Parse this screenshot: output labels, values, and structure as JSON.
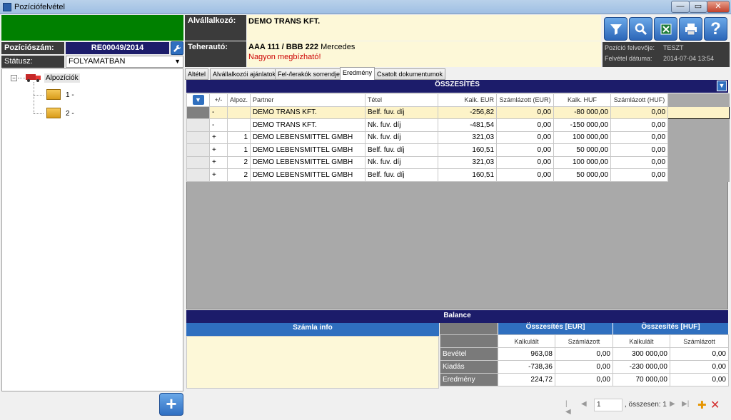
{
  "window": {
    "title": "Pozíciófelvétel",
    "min": "—",
    "max": "▭",
    "close": "✕"
  },
  "left": {
    "pos_label": "Pozíciószám:",
    "pos_value": "RE00049/2014",
    "status_label": "Státusz:",
    "status_value": "FOLYAMATBAN",
    "tree": {
      "root": "Alpozíciók",
      "children": [
        "1 -",
        "2 -"
      ]
    }
  },
  "header": {
    "subcontractor_label": "Alvállalkozó:",
    "subcontractor_value": "DEMO TRANS KFT.",
    "truck_label": "Teherautó:",
    "truck_plate": "AAA 111 / BBB 222",
    "truck_make": "Mercedes",
    "truck_note": "Nagyon megbízható!",
    "info": {
      "creator_label": "Pozíció felvevője:",
      "creator_value": "TESZT",
      "date_label": "Felvétel dátuma:",
      "date_value": "2014-07-04 13:54"
    }
  },
  "tabs": [
    "Altétel",
    "Alvállalkozói ajánlatok",
    "Fel-/lerakók sorrendje",
    "Eredmény",
    "Csatolt dokumentumok"
  ],
  "active_tab": "Eredmény",
  "summary": {
    "title": "ÖSSZESÍTÉS",
    "columns": [
      "+/-",
      "Alpoz.",
      "Partner",
      "Tétel",
      "Kalk. EUR",
      "Számlázott (EUR)",
      "Kalk. HUF",
      "Számlázott (HUF)"
    ],
    "rows": [
      [
        "-",
        "",
        "DEMO TRANS KFT.",
        "Belf. fuv. díj",
        "-256,82",
        "0,00",
        "-80 000,00",
        "0,00"
      ],
      [
        "-",
        "",
        "DEMO TRANS KFT.",
        "Nk. fuv. díj",
        "-481,54",
        "0,00",
        "-150 000,00",
        "0,00"
      ],
      [
        "+",
        "1",
        "DEMO LEBENSMITTEL GMBH",
        "Nk. fuv. díj",
        "321,03",
        "0,00",
        "100 000,00",
        "0,00"
      ],
      [
        "+",
        "1",
        "DEMO LEBENSMITTEL GMBH",
        "Belf. fuv. díj",
        "160,51",
        "0,00",
        "50 000,00",
        "0,00"
      ],
      [
        "+",
        "2",
        "DEMO LEBENSMITTEL GMBH",
        "Nk. fuv. díj",
        "321,03",
        "0,00",
        "100 000,00",
        "0,00"
      ],
      [
        "+",
        "2",
        "DEMO LEBENSMITTEL GMBH",
        "Belf. fuv. díj",
        "160,51",
        "0,00",
        "50 000,00",
        "0,00"
      ]
    ]
  },
  "balance": {
    "title": "Balance",
    "invoice_info": "Számla info",
    "eur_header": "Összesítés [EUR]",
    "huf_header": "Összesítés [HUF]",
    "sub_headers": [
      "Kalkulált",
      "Számlázott",
      "Kalkulált",
      "Számlázott"
    ],
    "rows": [
      {
        "label": "Bevétel",
        "values": [
          "963,08",
          "0,00",
          "300 000,00",
          "0,00"
        ]
      },
      {
        "label": "Kiadás",
        "values": [
          "-738,36",
          "0,00",
          "-230 000,00",
          "0,00"
        ]
      },
      {
        "label": "Eredmény",
        "values": [
          "224,72",
          "0,00",
          "70 000,00",
          "0,00"
        ]
      }
    ]
  },
  "pager": {
    "page": "1",
    "total": ", összesen: 1"
  },
  "icons": {
    "add": "+",
    "wrench": "🔧",
    "filter": "▼",
    "search": "🔍",
    "excel": "X",
    "print": "🖶",
    "help": "?"
  },
  "colors": {
    "navy": "#1c1c6a",
    "green": "#008000",
    "accent": "#2f6fbf",
    "note": "#cc0000"
  }
}
